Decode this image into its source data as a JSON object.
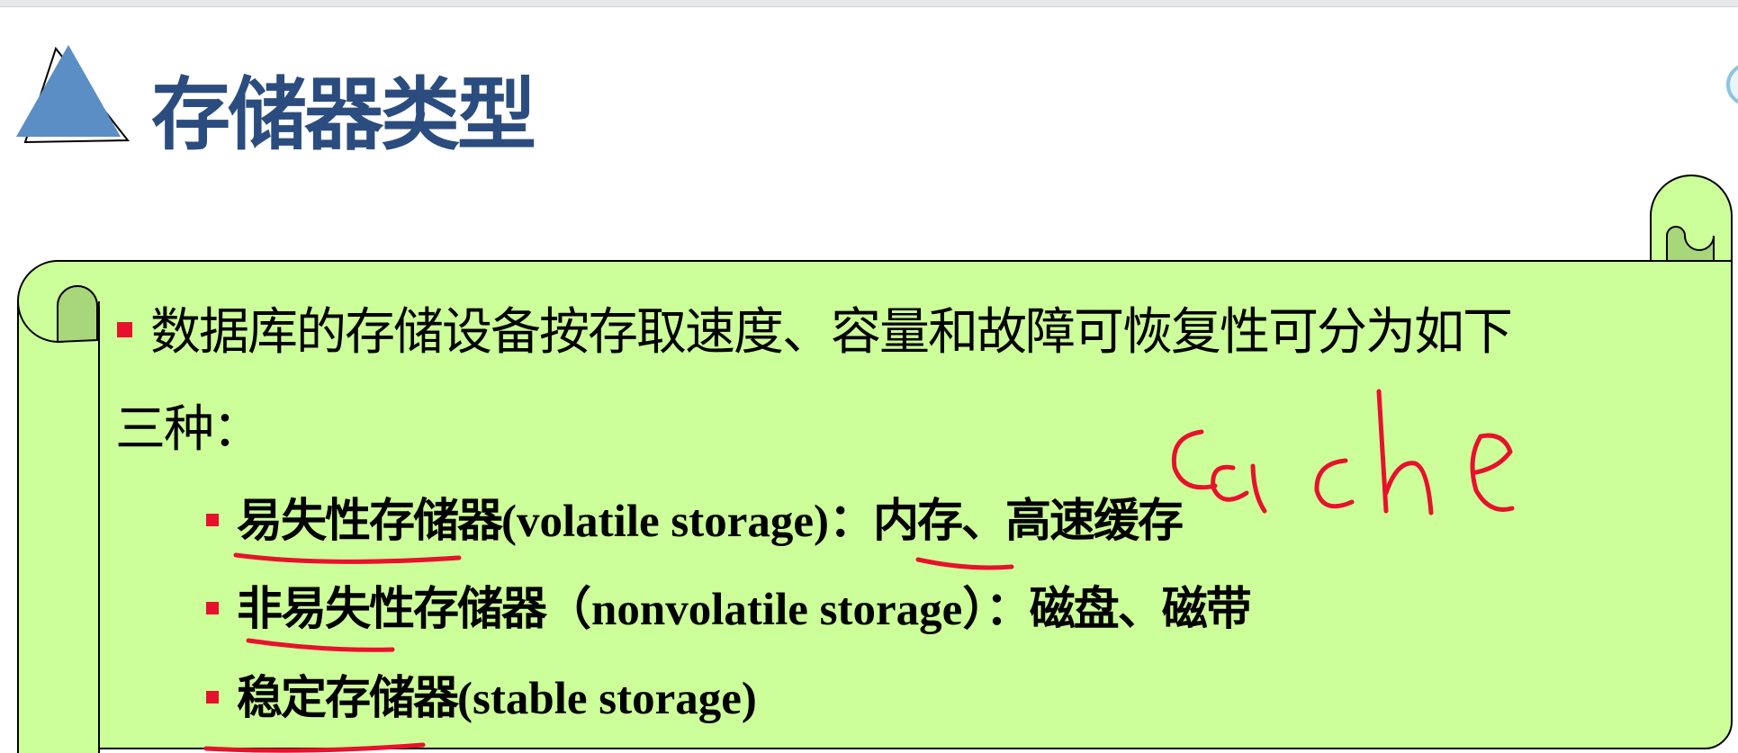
{
  "slide": {
    "title": "存储器类型",
    "main_point": "数据库的存储设备按存取速度、容量和故障可恢复性可分为如下",
    "main_point_cont": "三种：",
    "items": [
      {
        "term": "易失性存储器",
        "english": "(volatile storage)",
        "separator": "：",
        "examples": "内存、高速缓存"
      },
      {
        "term": "非易失性存储器",
        "english": "（nonvolatile storage）",
        "separator": "：",
        "examples": "磁盘、磁带"
      },
      {
        "term": "稳定存储器",
        "english": "(stable storage)",
        "separator": "",
        "examples": ""
      }
    ]
  },
  "colors": {
    "title": "#2b4c7e",
    "scroll_fill": "#ccff99",
    "scroll_dark": "#a8d67a",
    "bullet": "#e8112d",
    "ink": "#e8112d",
    "triangle": "#5b8ec4"
  },
  "annotation": {
    "text": "cache",
    "type": "handwritten"
  }
}
